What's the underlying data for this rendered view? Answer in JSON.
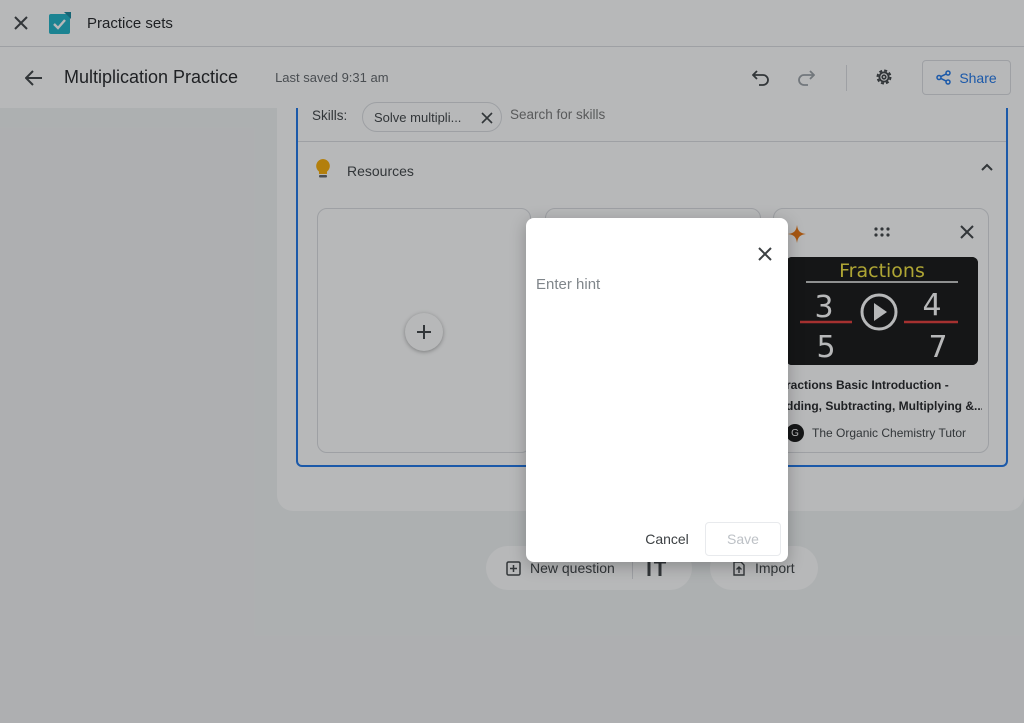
{
  "app": {
    "title": "Practice sets",
    "brand_color": "#1ab2c6"
  },
  "doc": {
    "title": "Multiplication Practice",
    "saved_status": "Last saved 9:31 am",
    "share_label": "Share",
    "accent_color": "#1a73e8"
  },
  "skills": {
    "label": "Skills:",
    "chip": "Solve multipli...",
    "search_placeholder": "Search for skills"
  },
  "resources": {
    "label": "Resources",
    "video": {
      "thumb_text": "Fractions",
      "fractions": [
        {
          "num": "3",
          "den": "5"
        },
        {
          "num": "4",
          "den": "7"
        }
      ],
      "title_line1": "ractions Basic Introduction -",
      "title_line2": "dding, Subtracting, Multiplying &...",
      "channel_initial": "G",
      "channel": "The Organic Chemistry Tutor"
    }
  },
  "bottom": {
    "new_question": "New question",
    "import": "Import"
  },
  "dialog": {
    "placeholder": "Enter hint",
    "cancel_label": "Cancel",
    "save_label": "Save"
  }
}
